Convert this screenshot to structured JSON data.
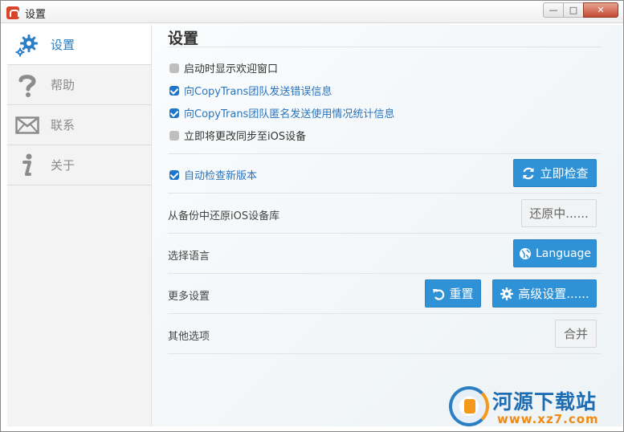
{
  "window": {
    "title": "设置",
    "controls": {
      "minimize": "—",
      "maximize": "□",
      "close": "✕"
    }
  },
  "sidebar": {
    "items": [
      {
        "label": "设置",
        "icon": "gear-icon",
        "active": true
      },
      {
        "label": "帮助",
        "icon": "question-icon",
        "active": false
      },
      {
        "label": "联系",
        "icon": "envelope-icon",
        "active": false
      },
      {
        "label": "关于",
        "icon": "info-icon",
        "active": false
      }
    ]
  },
  "main": {
    "title": "设置",
    "options": [
      {
        "label": "启动时显示欢迎窗口",
        "checked": false
      },
      {
        "label": "向CopyTrans团队发送错误信息",
        "checked": true
      },
      {
        "label": "向CopyTrans团队匿名发送使用情况统计信息",
        "checked": true
      },
      {
        "label": "立即将更改同步至iOS设备",
        "checked": false
      }
    ],
    "auto_check": {
      "label": "自动检查新版本",
      "checked": true,
      "button": "立即检查"
    },
    "restore": {
      "label": "从备份中还原iOS设备库",
      "button": "还原中......"
    },
    "language": {
      "label": "选择语言",
      "button": "Language"
    },
    "more": {
      "label": "更多设置",
      "reset_button": "重置",
      "advanced_button": "高级设置......"
    },
    "other": {
      "label": "其他选项",
      "button": "合并"
    }
  },
  "watermark": {
    "name": "河源下载站",
    "url": "www.xz7.com"
  },
  "colors": {
    "accent": "#2f91d6",
    "link": "#2a74be",
    "checkbox_on": "#1f76c9",
    "checkbox_off": "#bfbfbf"
  }
}
